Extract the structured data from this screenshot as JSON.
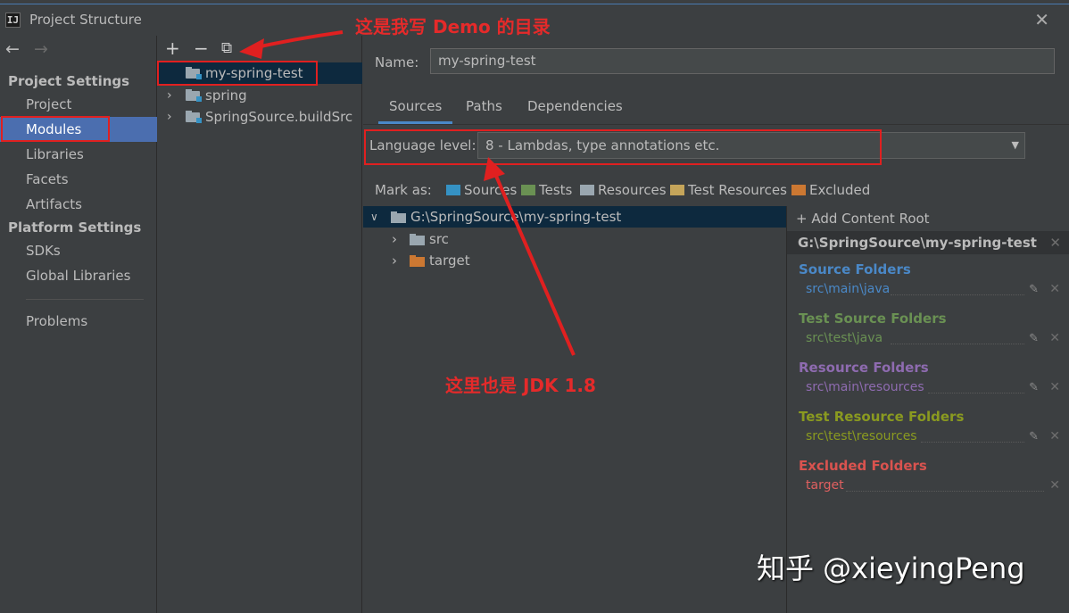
{
  "window": {
    "app_icon": "IJ",
    "title": "Project Structure",
    "close_glyph": "✕"
  },
  "nav": {
    "back": "←",
    "forward": "→"
  },
  "sidebar": {
    "project_settings": "Project Settings",
    "items": [
      {
        "label": "Project"
      },
      {
        "label": "Modules",
        "selected": true
      },
      {
        "label": "Libraries"
      },
      {
        "label": "Facets"
      },
      {
        "label": "Artifacts"
      }
    ],
    "platform_settings": "Platform Settings",
    "platform_items": [
      {
        "label": "SDKs"
      },
      {
        "label": "Global Libraries"
      }
    ],
    "problems": "Problems"
  },
  "module_toolbar": {
    "add": "+",
    "remove": "−",
    "copy": "⧉"
  },
  "modules": [
    {
      "name": "my-spring-test",
      "selected": true
    },
    {
      "name": "spring",
      "expand": "›"
    },
    {
      "name": "SpringSource.buildSrc",
      "expand": "›"
    }
  ],
  "detail": {
    "name_label": "Name:",
    "name_value": "my-spring-test",
    "tabs": [
      "Sources",
      "Paths",
      "Dependencies"
    ],
    "language_level_label": "Language level:",
    "language_level_value": "8 - Lambdas, type annotations etc.",
    "dropdown_arrow": "▼",
    "mark_as_label": "Mark as:",
    "mark_buttons": [
      {
        "label": "Sources",
        "color": "#3592c4"
      },
      {
        "label": "Tests",
        "color": "#6a9153"
      },
      {
        "label": "Resources",
        "color": "#9aa7b0"
      },
      {
        "label": "Test Resources",
        "color": "#c5a55a"
      },
      {
        "label": "Excluded",
        "color": "#cc7832"
      }
    ]
  },
  "content_tree": {
    "root": "G:\\SpringSource\\my-spring-test",
    "children": [
      {
        "name": "src",
        "color": "#9aa7b0"
      },
      {
        "name": "target",
        "color": "#cc7832"
      }
    ]
  },
  "content_root_panel": {
    "add_label": "+ Add Content Root",
    "root_path": "G:\\SpringSource\\my-spring-test",
    "groups": [
      {
        "title": "Source Folders",
        "path": "src\\main\\java",
        "color": "#4a88c7",
        "path_color": "#4a88c7"
      },
      {
        "title": "Test Source Folders",
        "path": "src\\test\\java",
        "color": "#6a9153",
        "path_color": "#6a9153"
      },
      {
        "title": "Resource Folders",
        "path": "src\\main\\resources",
        "color": "#8e6bb0",
        "path_color": "#8e6bb0"
      },
      {
        "title": "Test Resource Folders",
        "path": "src\\test\\resources",
        "color": "#8a9a20",
        "path_color": "#8a9a20"
      },
      {
        "title": "Excluded Folders",
        "path": "target",
        "color": "#d9534f",
        "path_color": "#e06060"
      }
    ]
  },
  "annotations": {
    "demo_dir": "这是我写 Demo 的目录",
    "jdk_note": "这里也是 JDK 1.8",
    "watermark": "知乎 @xieyingPeng",
    "color": "#e02020"
  }
}
